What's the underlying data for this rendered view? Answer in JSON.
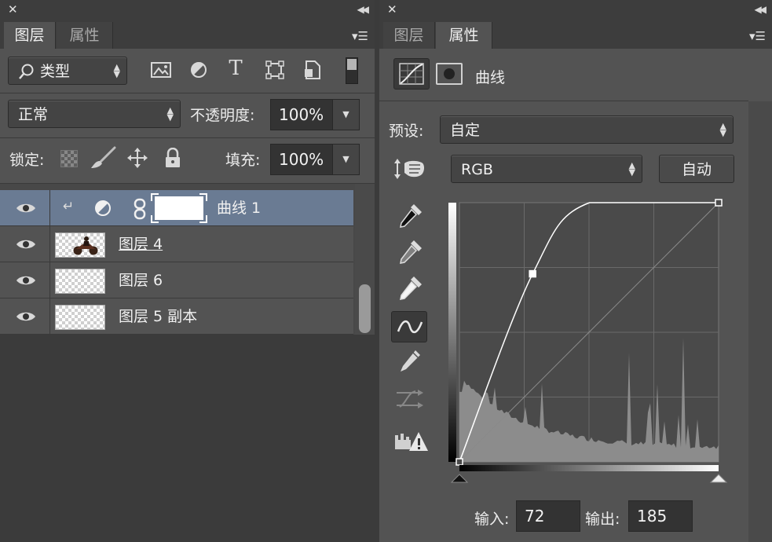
{
  "left_panel": {
    "tabs": [
      {
        "label": "图层",
        "active": true
      },
      {
        "label": "属性",
        "active": false
      }
    ],
    "filter": {
      "label": "类型"
    },
    "blend_mode": {
      "value": "正常"
    },
    "opacity": {
      "label": "不透明度:",
      "value": "100%"
    },
    "lock": {
      "label": "锁定:"
    },
    "fill": {
      "label": "填充:",
      "value": "100%"
    },
    "layers": [
      {
        "name": "曲线 1",
        "selected": true,
        "type": "adjustment"
      },
      {
        "name": "图层 4",
        "selected": false,
        "type": "image"
      },
      {
        "name": "图层 6",
        "selected": false,
        "type": "transparent"
      },
      {
        "name": "图层 5 副本",
        "selected": false,
        "type": "transparent"
      }
    ]
  },
  "right_panel": {
    "tabs": [
      {
        "label": "图层",
        "active": false
      },
      {
        "label": "属性",
        "active": true
      }
    ],
    "header_title": "曲线",
    "preset": {
      "label": "预设:",
      "value": "自定"
    },
    "channel": {
      "value": "RGB"
    },
    "auto_button": "自动",
    "input": {
      "label": "输入:",
      "value": "72"
    },
    "output": {
      "label": "输出:",
      "value": "185"
    }
  },
  "chart_data": {
    "type": "line",
    "title": "",
    "xlabel": "",
    "ylabel": "",
    "xlim": [
      0,
      255
    ],
    "ylim": [
      0,
      255
    ],
    "grid": true,
    "series": [
      {
        "values_x": [
          0,
          72,
          128,
          255
        ],
        "values_y": [
          0,
          185,
          255,
          255
        ]
      }
    ],
    "control_points": [
      [
        0,
        0
      ],
      [
        72,
        185
      ],
      [
        255,
        255
      ]
    ],
    "selected_point": [
      72,
      185
    ],
    "colors": {
      "curve": "#ffffff",
      "histogram": "#8c8c8c",
      "grid": "#6a6a6a",
      "plot_bg": "#4a4a4a"
    }
  }
}
